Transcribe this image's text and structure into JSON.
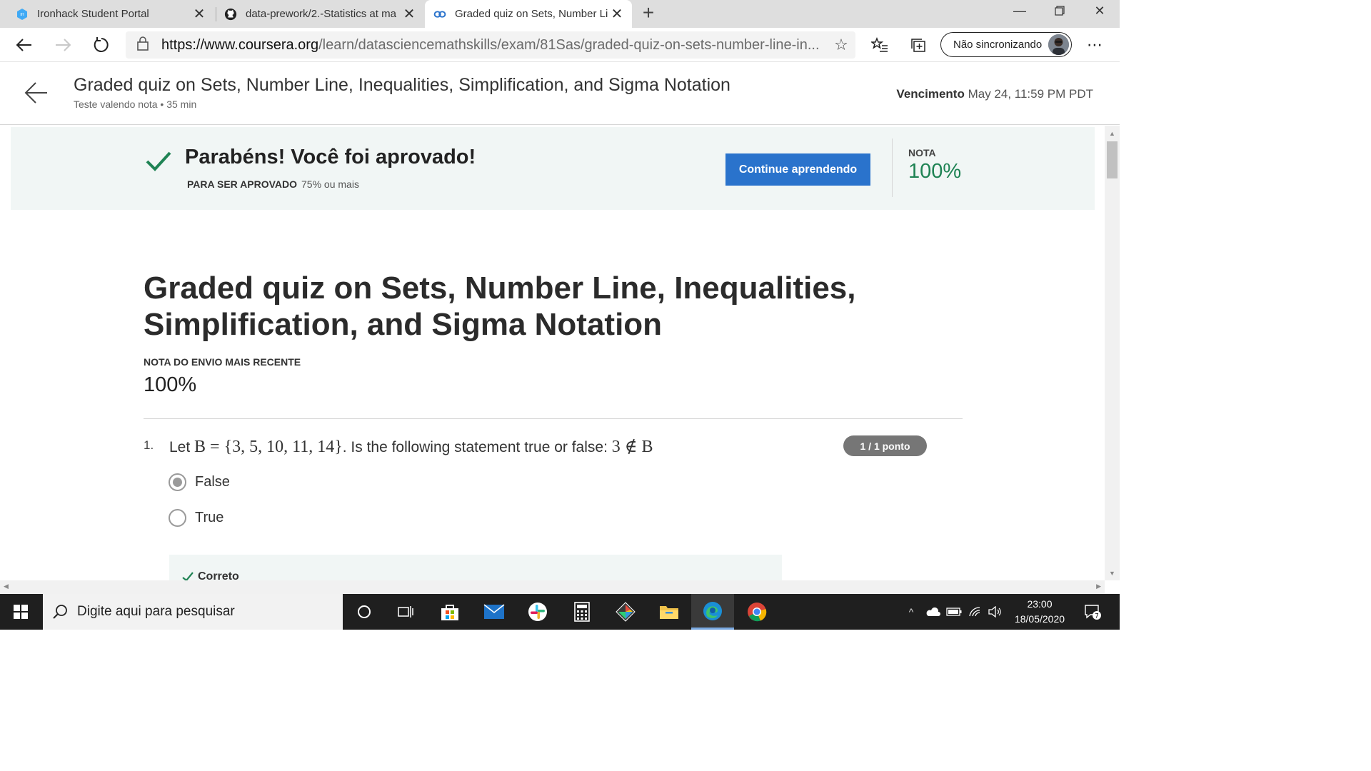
{
  "browser": {
    "tabs": [
      {
        "title": "Ironhack Student Portal",
        "icon": "ironhack-icon",
        "active": false
      },
      {
        "title": "data-prework/2.-Statistics at ma",
        "icon": "github-icon",
        "active": false
      },
      {
        "title": "Graded quiz on Sets, Number Lir",
        "icon": "coursera-icon",
        "active": true
      }
    ],
    "url_domain": "https://www.coursera.org",
    "url_path": "/learn/datasciencemathskills/exam/81Sas/graded-quiz-on-sets-number-line-in...",
    "sync_label": "Não sincronizando"
  },
  "page_header": {
    "title": "Graded quiz on Sets, Number Line, Inequalities, Simplification, and Sigma Notation",
    "subtitle": "Teste valendo nota • 35 min",
    "due_label": "Vencimento",
    "due_value": "May 24, 11:59 PM PDT"
  },
  "banner": {
    "headline": "Parabéns! Você foi aprovado!",
    "pass_label": "PARA SER APROVADO",
    "pass_value": "75% ou mais",
    "cta": "Continue aprendendo",
    "grade_label": "NOTA",
    "grade_value": "100%",
    "accent": "#1f8354",
    "cta_color": "#2a73cc"
  },
  "main": {
    "title": "Graded quiz on Sets, Number Line, Inequalities, Simplification, and Sigma Notation",
    "latest_label": "NOTA DO ENVIO MAIS RECENTE",
    "latest_value": "100%",
    "question": {
      "number": "1.",
      "prefix": "Let ",
      "set_math": "B = {3, 5, 10, 11, 14}",
      "middle": ". Is the following statement true or false: ",
      "stmt_math": "3 ∉ B",
      "points": "1 / 1 ponto",
      "options": [
        {
          "label": "False",
          "selected": true
        },
        {
          "label": "True",
          "selected": false
        }
      ],
      "feedback": "Correto"
    }
  },
  "taskbar": {
    "search_placeholder": "Digite aqui para pesquisar",
    "time": "23:00",
    "date": "18/05/2020",
    "notifications": "7"
  }
}
